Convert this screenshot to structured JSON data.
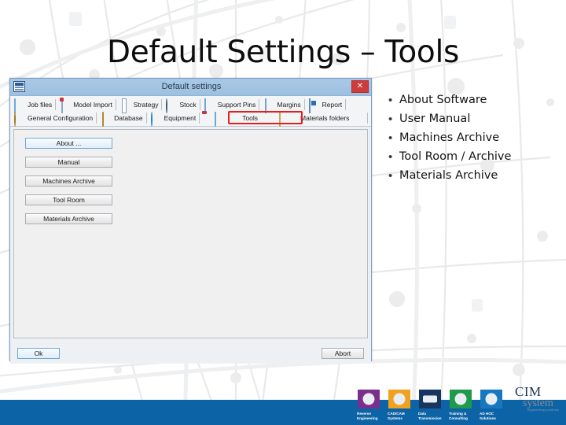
{
  "slide": {
    "title": "Default Settings – Tools"
  },
  "bullets": [
    {
      "text": "About Software"
    },
    {
      "text": "User Manual"
    },
    {
      "text": "Machines Archive"
    },
    {
      "text": "Tool Room / Archive"
    },
    {
      "text": "Materials Archive"
    }
  ],
  "dialog": {
    "title": "Default settings",
    "close_label": "✕",
    "toolbar": {
      "row1": [
        {
          "label": "Job files",
          "icon": "folder-icon",
          "shape": "ico-folder"
        },
        {
          "label": "Model Import",
          "icon": "document-import-icon",
          "shape": "ico-doc-red"
        },
        {
          "label": "Strategy",
          "icon": "list-icon",
          "shape": "ico-list"
        },
        {
          "label": "Stock",
          "icon": "sphere-icon",
          "shape": "ico-circle-dark"
        },
        {
          "label": "Support Pins",
          "icon": "support-pins-icon",
          "shape": "ico-pin"
        },
        {
          "label": "Margins",
          "icon": "page-icon",
          "shape": "ico-page"
        },
        {
          "label": "Report",
          "icon": "report-icon",
          "shape": "ico-report"
        }
      ],
      "row2": [
        {
          "label": "General Configuration",
          "icon": "gear-icon",
          "shape": "ico-gear"
        },
        {
          "label": "Database",
          "icon": "database-folder-icon",
          "shape": "ico-doc-yellow"
        },
        {
          "label": "Equipment",
          "icon": "equipment-icon",
          "shape": "ico-circle-blue"
        },
        {
          "label": "Tools",
          "icon": "tools-folder-icon",
          "shape": "ico-folder-open"
        },
        {
          "label": "Materials folders",
          "icon": "materials-folder-icon",
          "shape": "ico-folder-tan"
        }
      ],
      "highlight": {
        "target": "Tools",
        "color": "#e81d1d"
      }
    },
    "side_buttons": [
      {
        "label": "About ...",
        "focused": true
      },
      {
        "label": "Manual",
        "focused": false
      },
      {
        "label": "Machines Archive",
        "focused": false
      },
      {
        "label": "Tool Room",
        "focused": false
      },
      {
        "label": "Materials Archive",
        "focused": false
      }
    ],
    "footer": {
      "ok_label": "Ok",
      "abort_label": "Abort"
    }
  },
  "footer": {
    "band_color": "#0c63a6",
    "logos": [
      {
        "caption1": "Reverse",
        "caption2": "Engineering",
        "color": "#7b2f8c",
        "icon": "reverse-engineering-icon"
      },
      {
        "caption1": "CAD/CAM",
        "caption2": "Systems",
        "color": "#f0a21e",
        "icon": "cadcam-systems-icon"
      },
      {
        "caption1": "Data",
        "caption2": "Transmission",
        "color": "#16355f",
        "icon": "data-transmission-icon"
      },
      {
        "caption1": "Training &",
        "caption2": "Consulting",
        "color": "#1f9a4a",
        "icon": "training-consulting-icon"
      },
      {
        "caption1": "AD HOC",
        "caption2": "Solutions",
        "color": "#1878bf",
        "icon": "adhoc-solutions-icon"
      }
    ],
    "brand": {
      "main": "CIM",
      "sub": "system",
      "tagline": "engineering solutions"
    }
  }
}
